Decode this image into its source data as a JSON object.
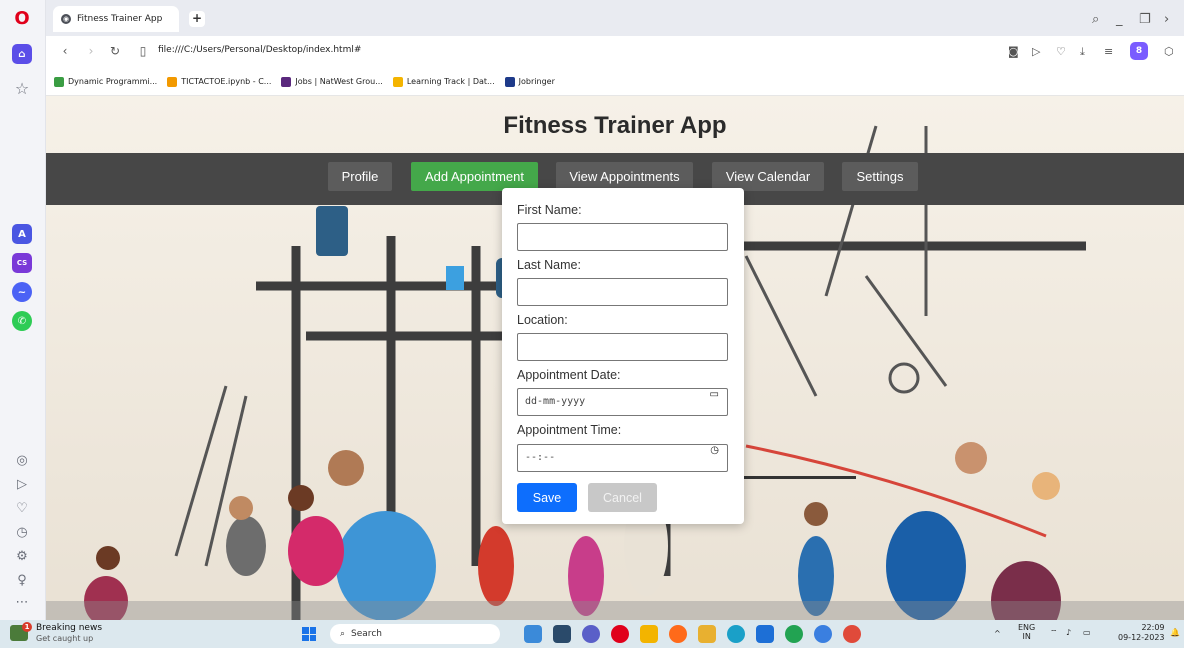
{
  "browser": {
    "logo": "O",
    "tab_title": "Fitness Trainer App",
    "new_tab_symbol": "+",
    "url": "file:///C:/Users/Personal/Desktop/index.html#",
    "profile_badge": "8",
    "bookmarks": [
      {
        "label": "Dynamic Programmi...",
        "color": "#3a9d43"
      },
      {
        "label": "TICTACTOE.ipynb - C...",
        "color": "#f29900"
      },
      {
        "label": "Jobs | NatWest Grou...",
        "color": "#5a287d"
      },
      {
        "label": "Learning Track | Dat...",
        "color": "#f4b400"
      },
      {
        "label": "Jobringer",
        "color": "#1e3a8a"
      }
    ]
  },
  "page": {
    "title": "Fitness Trainer App",
    "nav": [
      {
        "label": "Profile",
        "active": false
      },
      {
        "label": "Add Appointment",
        "active": true
      },
      {
        "label": "View Appointments",
        "active": false
      },
      {
        "label": "View Calendar",
        "active": false
      },
      {
        "label": "Settings",
        "active": false
      }
    ],
    "form": {
      "first_name_label": "First Name:",
      "last_name_label": "Last Name:",
      "location_label": "Location:",
      "date_label": "Appointment Date:",
      "date_placeholder": "dd-mm-yyyy",
      "time_label": "Appointment Time:",
      "time_placeholder": "--:--",
      "save_label": "Save",
      "cancel_label": "Cancel"
    }
  },
  "taskbar": {
    "news_title": "Breaking news",
    "news_sub": "Get caught up",
    "news_badge": "1",
    "search_label": "Search",
    "lang_top": "ENG",
    "lang_bottom": "IN",
    "time": "22:09",
    "date": "09-12-2023"
  },
  "colors": {
    "nav_bar": "#474747",
    "nav_active": "#44a84a",
    "save_button": "#0d6efd",
    "cancel_button": "#c8c8c8"
  }
}
